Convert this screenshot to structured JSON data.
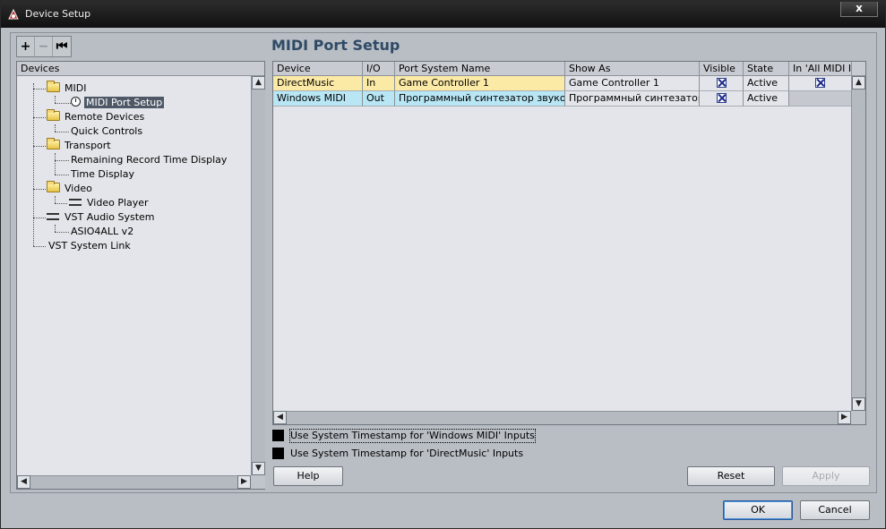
{
  "window": {
    "title": "Device Setup",
    "close_label": "x"
  },
  "toolbar": {
    "add_label": "+",
    "remove_label": "−",
    "reset_label": "⏮"
  },
  "tree": {
    "header": "Devices",
    "items": [
      {
        "label": "MIDI",
        "icon": "folder-icon"
      },
      {
        "label": "MIDI Port Setup",
        "icon": "clock-icon",
        "selected": true
      },
      {
        "label": "Remote Devices",
        "icon": "folder-icon"
      },
      {
        "label": "Quick Controls",
        "icon": ""
      },
      {
        "label": "Transport",
        "icon": "folder-icon"
      },
      {
        "label": "Remaining Record Time Display",
        "icon": ""
      },
      {
        "label": "Time Display",
        "icon": ""
      },
      {
        "label": "Video",
        "icon": "folder-icon"
      },
      {
        "label": "Video Player",
        "icon": "video-icon"
      },
      {
        "label": "VST Audio System",
        "icon": "audio-icon"
      },
      {
        "label": "ASIO4ALL v2",
        "icon": ""
      },
      {
        "label": "VST System Link",
        "icon": ""
      }
    ]
  },
  "main": {
    "title": "MIDI Port Setup",
    "columns": [
      "Device",
      "I/O",
      "Port System Name",
      "Show As",
      "Visible",
      "State",
      "In 'All MIDI Inputs'"
    ],
    "rows": [
      {
        "device": "DirectMusic",
        "io": "In",
        "port": "Game Controller 1",
        "show_as": "Game Controller 1",
        "visible": true,
        "state": "Active",
        "in_all": true,
        "color": "#fbe9a6"
      },
      {
        "device": "Windows MIDI",
        "io": "Out",
        "port": "Программный синтезатор звуковой",
        "show_as": "Программный синтезатор зв",
        "visible": true,
        "state": "Active",
        "in_all": null,
        "color": "#b8e6f5"
      }
    ],
    "options": [
      {
        "label": "Use System Timestamp for 'Windows MIDI' Inputs",
        "checked": false
      },
      {
        "label": "Use System Timestamp for 'DirectMusic' Inputs",
        "checked": false
      }
    ]
  },
  "buttons": {
    "help": "Help",
    "reset": "Reset",
    "apply": "Apply",
    "ok": "OK",
    "cancel": "Cancel"
  },
  "colors": {
    "title_text": "#2f4a66",
    "selection": "#4f5866",
    "row_in": "#fbe9a6",
    "row_out": "#b8e6f5"
  }
}
